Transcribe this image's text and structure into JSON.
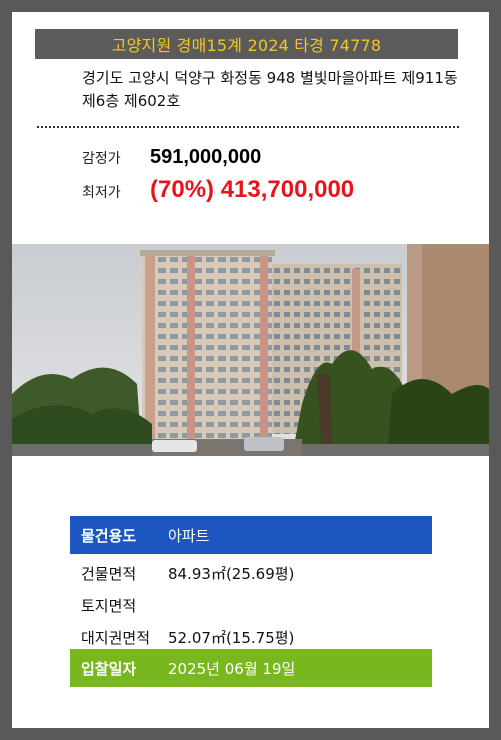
{
  "header": {
    "title": "고양지원 경매15계 2024 타경 74778"
  },
  "property": {
    "address": "경기도 고양시 덕양구 화정동 948 별빛마을아파트 제911동 제6층 제602호"
  },
  "prices": {
    "appraisal_label": "감정가",
    "appraisal_value": "591,000,000",
    "minimum_label": "최저가",
    "minimum_value": "(70%) 413,700,000"
  },
  "details": {
    "usage_label": "물건용도",
    "usage_value": "아파트",
    "building_area_label": "건물면적",
    "building_area_value": "84.93㎡(25.69평)",
    "land_area_label": "토지면적",
    "land_area_value": "",
    "land_right_label": "대지권면적",
    "land_right_value": "52.07㎡(15.75평)",
    "bid_date_label": "입찰일자",
    "bid_date_value": "2025년 06월 19일"
  },
  "colors": {
    "background": "#595959",
    "title_text": "#f3c623",
    "min_price": "#e8141b",
    "usage_row": "#1c56be",
    "bid_row": "#79b71e"
  }
}
